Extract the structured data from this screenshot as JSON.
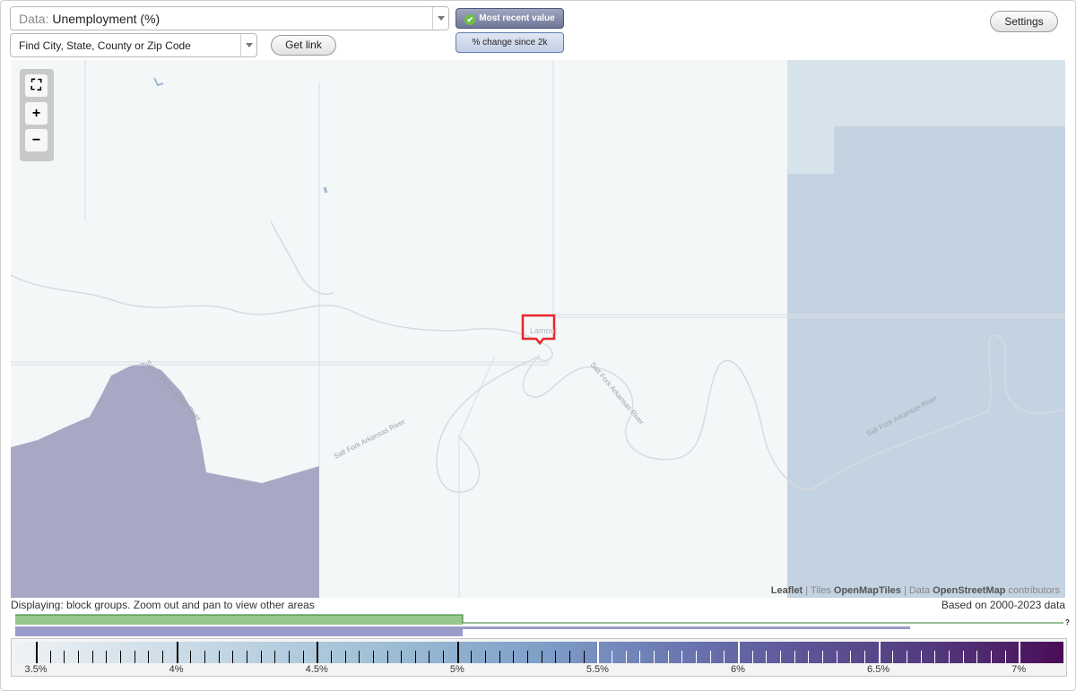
{
  "data_select": {
    "label": "Data:",
    "value": "Unemployment (%)"
  },
  "search": {
    "placeholder": "Find City, State, County or Zip Code"
  },
  "get_link_label": "Get link",
  "toggle": {
    "most_recent": "Most recent value",
    "change_since": "% change since 2k"
  },
  "settings_label": "Settings",
  "map": {
    "town_label": "Lamont",
    "rivers": [
      "Salt Fork Arkansas River",
      "Salt Fork Arkansas River",
      "Salt Fork Arkansas River",
      "Salt Fork Arkansas River"
    ],
    "attribution": {
      "leaflet": "Leaflet",
      "tiles_prefix": "| Tiles",
      "tiles": "OpenMapTiles",
      "data_prefix": "| Data",
      "data": "OpenStreetMap",
      "suffix": "contributors"
    },
    "colors": {
      "base": "#f3f7f8",
      "purple_region": "#a9a8c4",
      "blue_region": "#c4d3e1",
      "highlight": "#e8252a"
    }
  },
  "caption": {
    "left": "Displaying: block groups. Zoom out and pan to view other areas",
    "right": "Based on 2000-2023 data"
  },
  "legend": {
    "labels": [
      "3.5%",
      "4%",
      "4.5%",
      "5%",
      "5.5%",
      "6%",
      "6.5%",
      "7%"
    ],
    "unknown_mark": "?",
    "colors": {
      "histogram_green": "#98c78c",
      "histogram_purple": "#9b9bc9"
    }
  }
}
